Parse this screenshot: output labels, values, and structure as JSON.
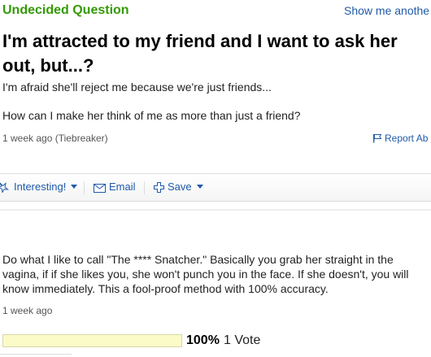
{
  "question": {
    "type_label": "Undecided Question",
    "show_other_link": "Show me anothe",
    "title": "I'm attracted to my friend and I want to ask her out, but...?",
    "body_line_1": "I'm afraid she'll reject me because we're just friends...",
    "body_line_2": "How can I make her think of me as more than just a friend?",
    "meta": "1 week ago (Tiebreaker)",
    "report_label": "Report Ab"
  },
  "actions": {
    "interesting_label": "Interesting!",
    "email_label": "Email",
    "save_label": "Save"
  },
  "answer": {
    "text": "Do what I like to call \"The **** Snatcher.\" Basically you grab her straight in the vagina, if if she likes you, she won't punch you in the face. If she doesn't, you will know immediately. This a fool-proof method with 100% accuracy.",
    "meta": "1 week ago",
    "vote_percent_label": "100%",
    "vote_fraction": 1.0,
    "vote_count_label": "1 Vote"
  },
  "colors": {
    "question_type": "#339a05",
    "link": "#1f5aa8",
    "vote_bar_fill": "#fbfbc8"
  },
  "icons": {
    "report": "flag-icon",
    "interesting": "star-icon",
    "email": "envelope-icon",
    "save": "plus-icon"
  }
}
